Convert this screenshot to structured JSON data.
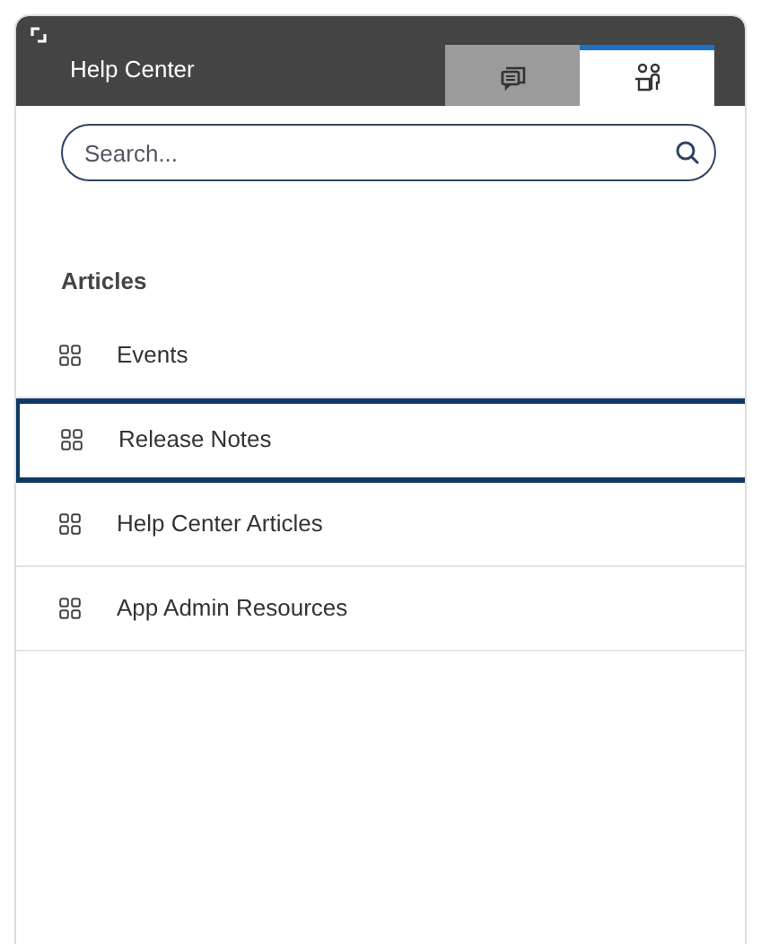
{
  "header": {
    "title": "Help Center"
  },
  "tabs": [
    {
      "kind": "chat",
      "selected": false
    },
    {
      "kind": "people",
      "selected": true
    }
  ],
  "search": {
    "placeholder": "Search..."
  },
  "section": {
    "title": "Articles"
  },
  "items": [
    {
      "label": "Events",
      "selected": false
    },
    {
      "label": "Release Notes",
      "selected": true
    },
    {
      "label": "Help Center Articles",
      "selected": false
    },
    {
      "label": "App Admin Resources",
      "selected": false
    }
  ]
}
